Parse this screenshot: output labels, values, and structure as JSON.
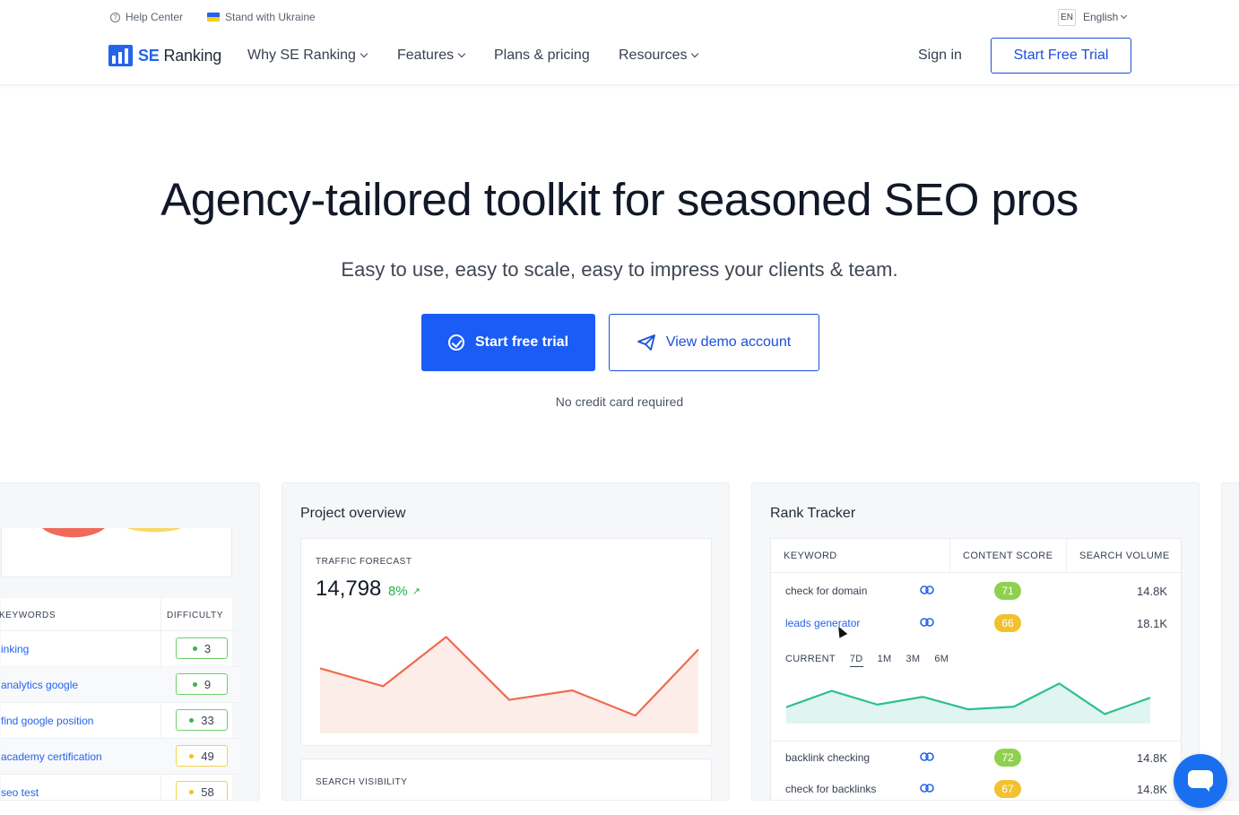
{
  "topbar": {
    "help": "Help Center",
    "ukraine": "Stand with Ukraine",
    "lang_code": "EN",
    "lang_label": "English"
  },
  "nav": {
    "logo_se": "SE",
    "logo_ranking": "Ranking",
    "why": "Why SE Ranking",
    "features": "Features",
    "plans": "Plans & pricing",
    "resources": "Resources",
    "signin": "Sign in",
    "trial": "Start Free Trial"
  },
  "hero": {
    "title": "Agency-tailored toolkit for seasoned SEO pros",
    "subtitle": "Easy to use, easy to scale, easy to impress your clients & team.",
    "primary_cta": "Start free trial",
    "secondary_cta": "View demo account",
    "note": "No credit card required"
  },
  "keyword_card": {
    "col_keywords": "KEYWORDS",
    "col_difficulty": "DIFFICULTY",
    "rows": [
      {
        "keyword": "inking",
        "difficulty": "3",
        "level": "green"
      },
      {
        "keyword": "analytics google",
        "difficulty": "9",
        "level": "green"
      },
      {
        "keyword": "find google position",
        "difficulty": "33",
        "level": "green"
      },
      {
        "keyword": "academy certification",
        "difficulty": "49",
        "level": "yellow"
      },
      {
        "keyword": "seo test",
        "difficulty": "58",
        "level": "yellow"
      }
    ]
  },
  "project_overview": {
    "title": "Project overview",
    "traffic_label": "TRAFFIC FORECAST",
    "traffic_value": "14,798",
    "traffic_change": "8%",
    "search_visibility_label": "SEARCH VISIBILITY",
    "forecast_series": [
      0.62,
      0.45,
      0.92,
      0.32,
      0.41,
      0.17,
      0.8
    ]
  },
  "rank_tracker": {
    "title": "Rank Tracker",
    "col_keyword": "KEYWORD",
    "col_score": "CONTENT SCORE",
    "col_volume": "SEARCH VOLUME",
    "rows": [
      {
        "keyword": "check for domain",
        "score": "71",
        "volume": "14.8K",
        "color": "#8fd14f"
      },
      {
        "keyword": "leads generator",
        "score": "66",
        "volume": "18.1K",
        "color": "#f2c12e"
      },
      {
        "keyword": "backlink checking",
        "score": "72",
        "volume": "14.8K",
        "color": "#8fd14f"
      },
      {
        "keyword": "check for backlinks",
        "score": "67",
        "volume": "14.8K",
        "color": "#f2c12e"
      }
    ],
    "periods": [
      "CURRENT",
      "7D",
      "1M",
      "3M",
      "6M"
    ],
    "active_period": "7D",
    "trend_series": [
      0.38,
      0.76,
      0.44,
      0.62,
      0.33,
      0.39,
      0.93,
      0.22,
      0.6
    ]
  },
  "colors": {
    "brand": "#1a5cf5",
    "forecast_line": "#ee6b4d",
    "trend_line": "#2dbf94"
  }
}
